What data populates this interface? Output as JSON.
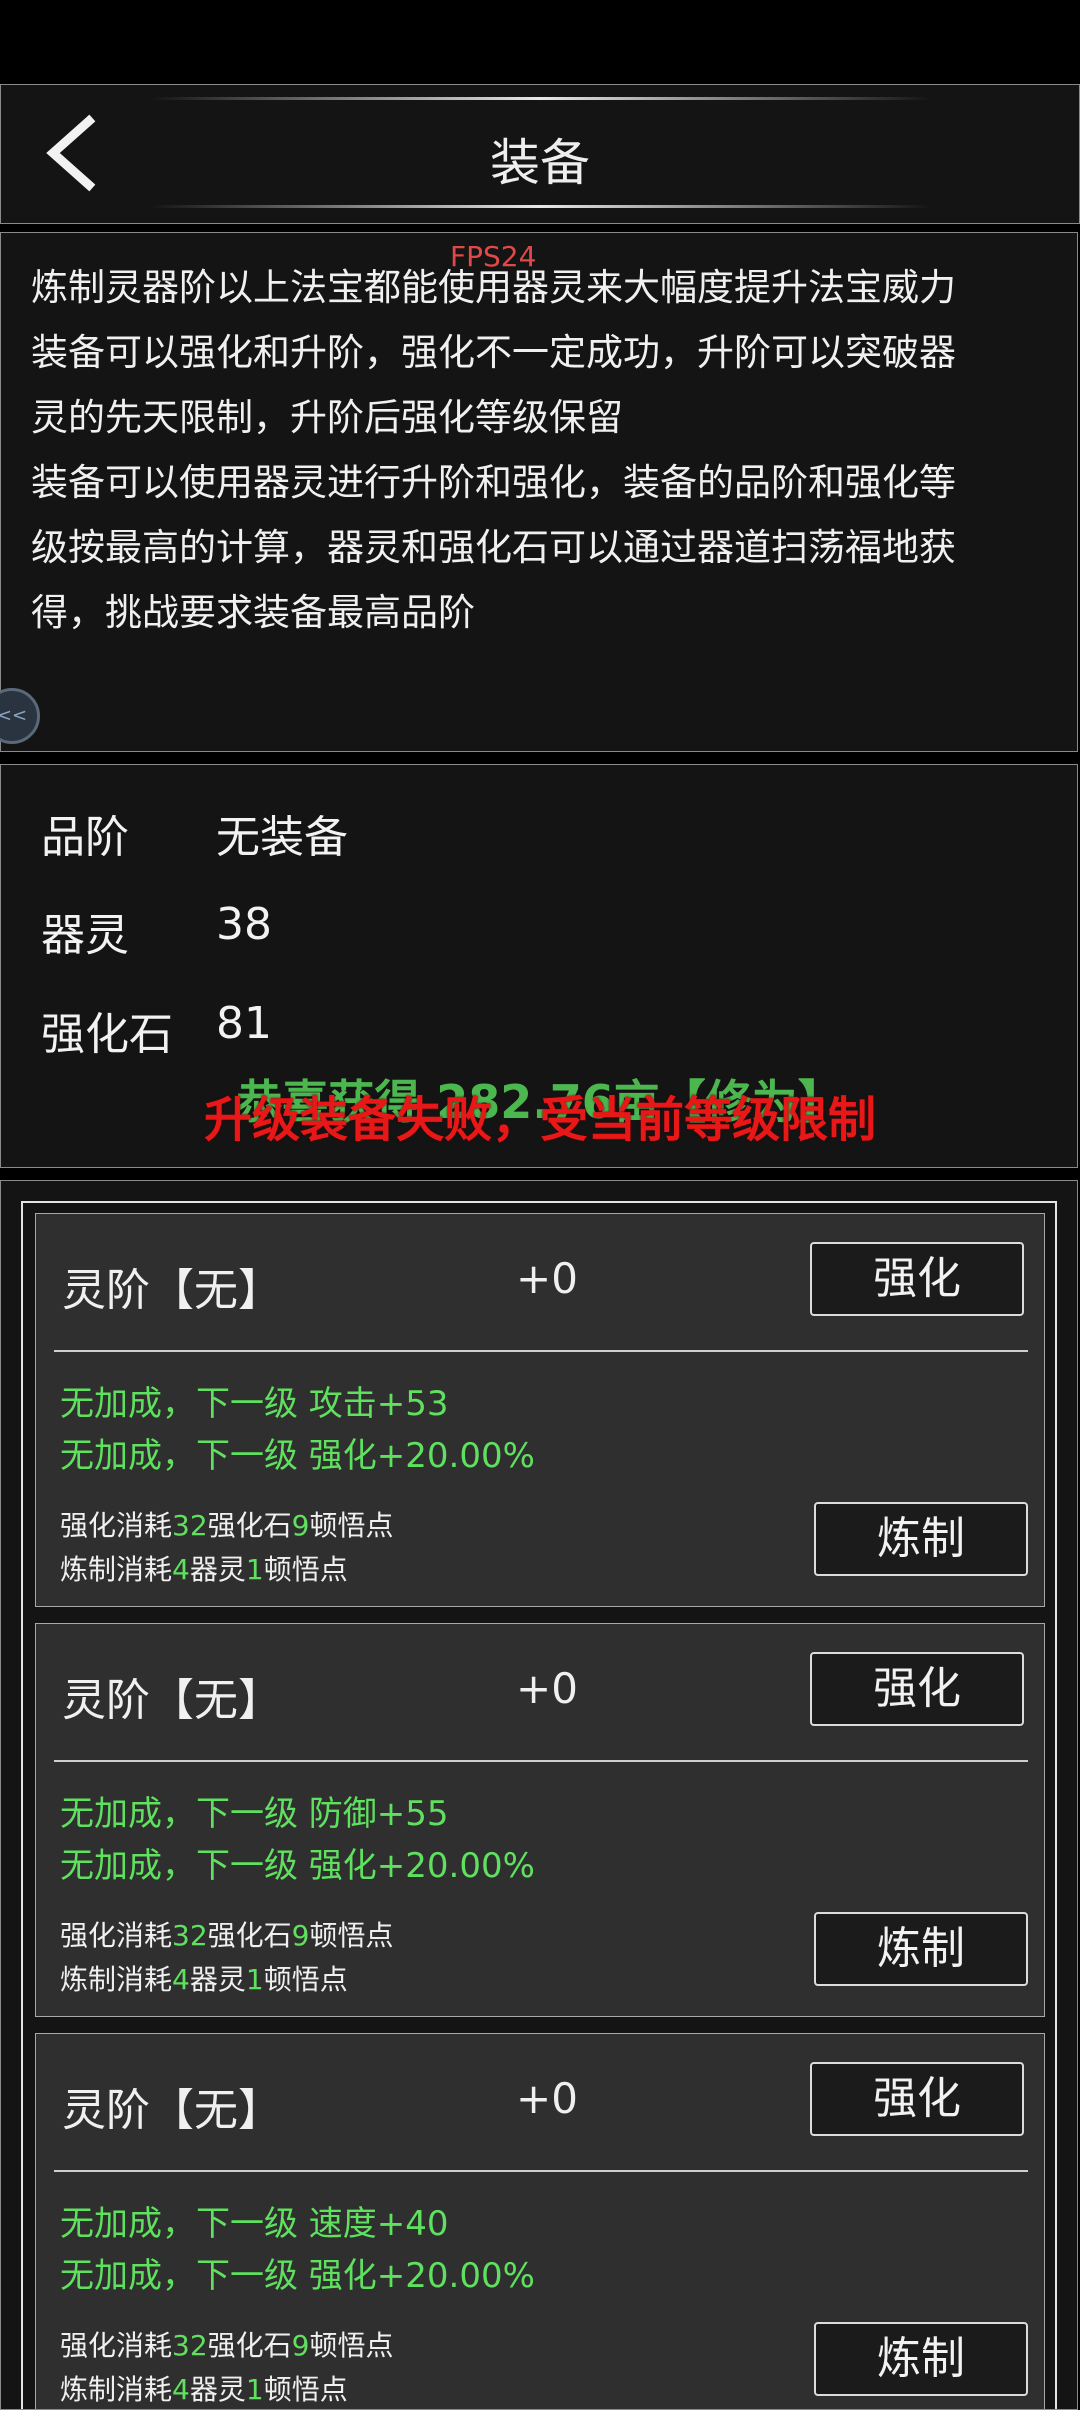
{
  "header": {
    "title": "装备",
    "back_icon": "chevron-left-icon"
  },
  "overlay": {
    "fps": "FPS24",
    "float_button_text": "<<"
  },
  "description": "炼制灵器阶以上法宝都能使用器灵来大幅度提升法宝威力\n装备可以强化和升阶，强化不一定成功，升阶可以突破器\n灵的先天限制，升阶后强化等级保留\n装备可以使用器灵进行升阶和强化，装备的品阶和强化等\n级按最高的计算，器灵和强化石可以通过器道扫荡福地获\n得，挑战要求装备最高品阶",
  "stats": [
    {
      "label": "品阶",
      "value": "无装备"
    },
    {
      "label": "器灵",
      "value": "38"
    },
    {
      "label": "强化石",
      "value": "81"
    }
  ],
  "toasts": {
    "green": "恭喜获得 282.76亩【修为】",
    "red": "升级装备失败，受当前等级限制"
  },
  "colors": {
    "accent_green": "#5fe05f",
    "error_red": "#e81818",
    "panel": "#141414",
    "card": "#2f2f2f"
  },
  "cards": [
    {
      "name": "灵阶【无】",
      "level": "+0",
      "enhance_label": "强化",
      "refine_label": "炼制",
      "bonus1": "无加成，下一级 攻击+53",
      "bonus2": "无加成，下一级 强化+20.00%",
      "cost1": {
        "prefix": "强化消耗",
        "n1": "32",
        "mid": "强化石",
        "n2": "9",
        "suffix": "顿悟点"
      },
      "cost2": {
        "prefix": "炼制消耗",
        "n1": "4",
        "mid": "器灵",
        "n2": "1",
        "suffix": "顿悟点"
      }
    },
    {
      "name": "灵阶【无】",
      "level": "+0",
      "enhance_label": "强化",
      "refine_label": "炼制",
      "bonus1": "无加成，下一级 防御+55",
      "bonus2": "无加成，下一级 强化+20.00%",
      "cost1": {
        "prefix": "强化消耗",
        "n1": "32",
        "mid": "强化石",
        "n2": "9",
        "suffix": "顿悟点"
      },
      "cost2": {
        "prefix": "炼制消耗",
        "n1": "4",
        "mid": "器灵",
        "n2": "1",
        "suffix": "顿悟点"
      }
    },
    {
      "name": "灵阶【无】",
      "level": "+0",
      "enhance_label": "强化",
      "refine_label": "炼制",
      "bonus1": "无加成，下一级 速度+40",
      "bonus2": "无加成，下一级 强化+20.00%",
      "cost1": {
        "prefix": "强化消耗",
        "n1": "32",
        "mid": "强化石",
        "n2": "9",
        "suffix": "顿悟点"
      },
      "cost2": {
        "prefix": "炼制消耗",
        "n1": "4",
        "mid": "器灵",
        "n2": "1",
        "suffix": "顿悟点"
      }
    }
  ]
}
